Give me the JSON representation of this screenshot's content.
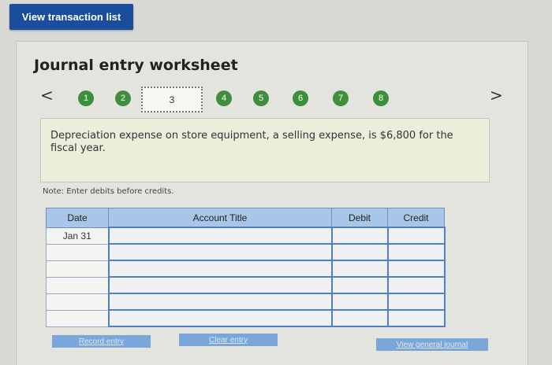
{
  "top_button": {
    "label": "View transaction list"
  },
  "worksheet": {
    "title": "Journal entry worksheet",
    "prev_arrow": "<",
    "next_arrow": ">",
    "steps": [
      "1",
      "2",
      "3",
      "4",
      "5",
      "6",
      "7",
      "8"
    ],
    "current_step": "3",
    "description": "Depreciation expense on store equipment, a selling expense, is $6,800 for the fiscal year.",
    "note": "Note: Enter debits before credits."
  },
  "table": {
    "headers": {
      "date": "Date",
      "account": "Account Title",
      "debit": "Debit",
      "credit": "Credit"
    },
    "rows": [
      {
        "date": "Jan 31"
      },
      {
        "date": ""
      },
      {
        "date": ""
      },
      {
        "date": ""
      },
      {
        "date": ""
      },
      {
        "date": ""
      }
    ]
  },
  "buttons": {
    "record": "Record entry",
    "clear": "Clear entry",
    "view_journal": "View general journal"
  },
  "colors": {
    "primary": "#1a4e9c",
    "step_green": "#3f8e3c",
    "table_header": "#a7c6e8",
    "input_border": "#4f80c7"
  }
}
